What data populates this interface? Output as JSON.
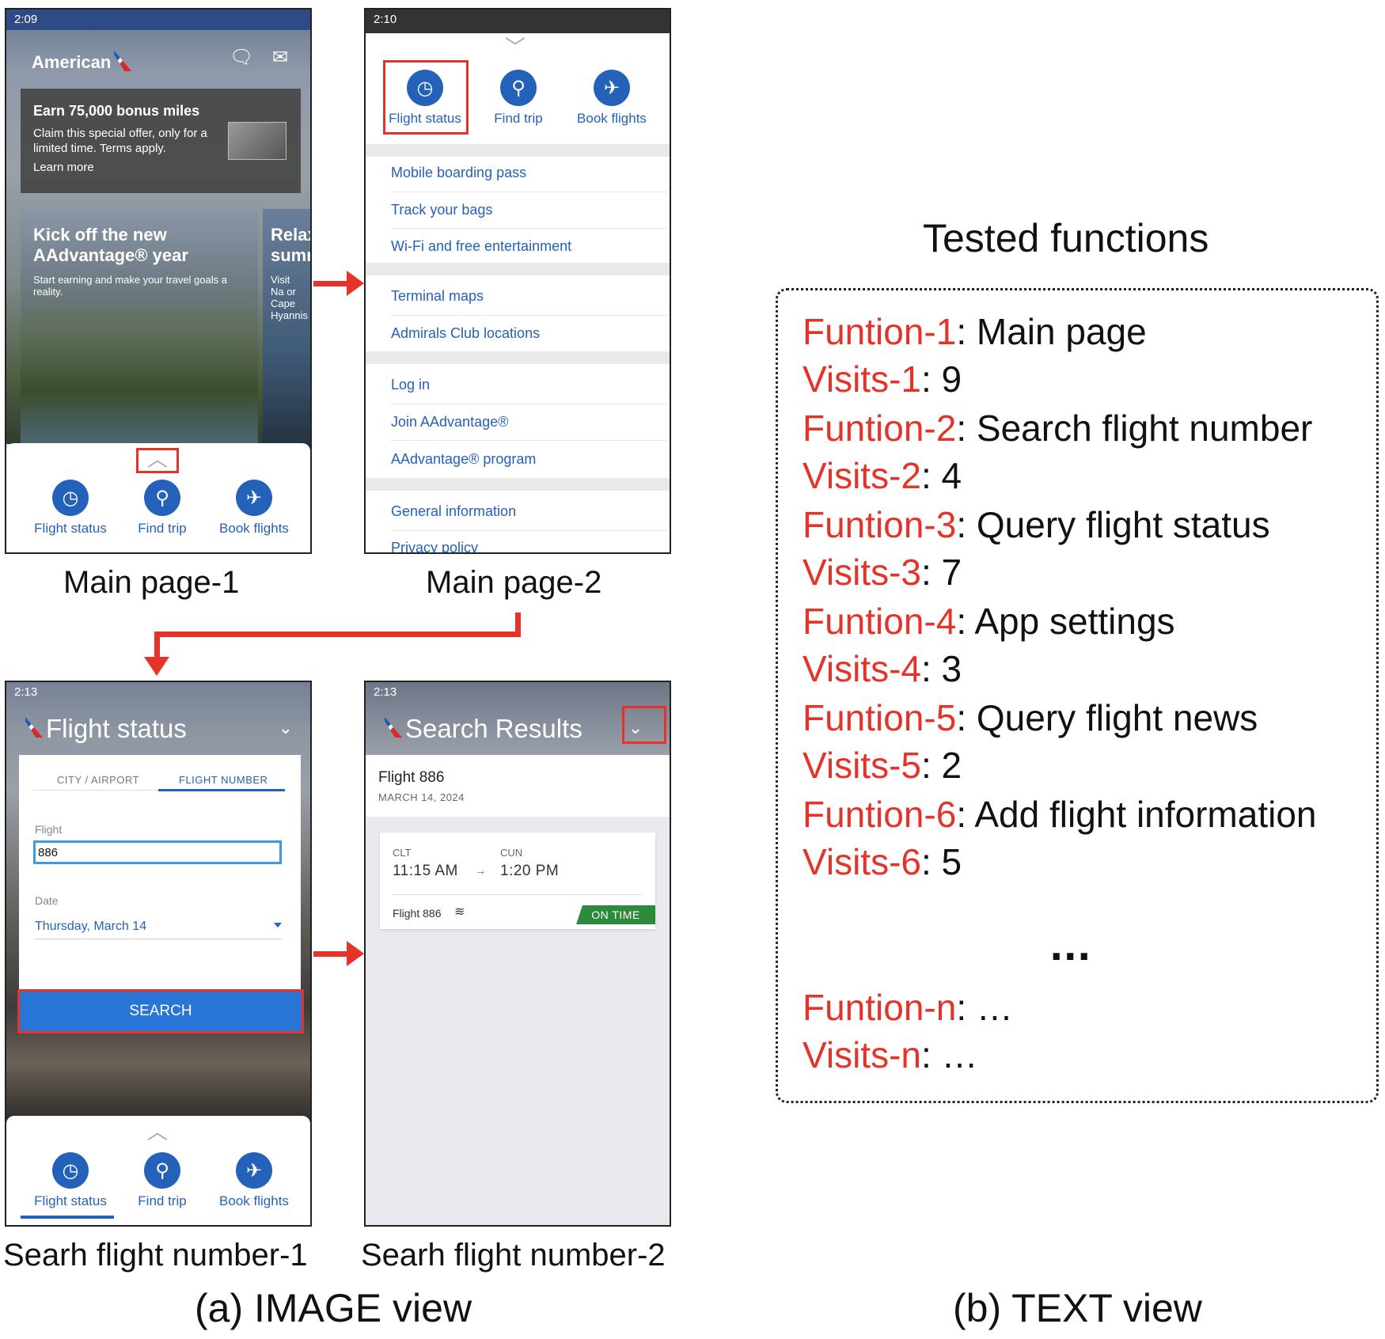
{
  "phone1": {
    "time": "2:09",
    "brand": "American",
    "promo": {
      "title": "Earn 75,000 bonus miles",
      "body": "Claim this special offer, only for a limited time. Terms apply.",
      "link": "Learn more"
    },
    "hero_a": {
      "headline": "Kick off the new AAdvantage® year",
      "sub": "Start earning and make your travel goals a reality."
    },
    "hero_b": {
      "headline": "Relax sumr",
      "sub": "Visit Na or Cape Hyannis"
    },
    "nav": [
      "Flight status",
      "Find trip",
      "Book flights"
    ]
  },
  "phone2": {
    "time": "2:10",
    "nav": [
      "Flight status",
      "Find trip",
      "Book flights"
    ],
    "menu_groups": [
      [
        "Mobile boarding pass",
        "Track your bags",
        "Wi-Fi and free entertainment"
      ],
      [
        "Terminal maps",
        "Admirals Club locations"
      ],
      [
        "Log in",
        "Join AAdvantage®",
        "AAdvantage® program"
      ],
      [
        "General information",
        "Privacy policy"
      ]
    ]
  },
  "phone3": {
    "time": "2:13",
    "title": "Flight status",
    "tabs": [
      "CITY / AIRPORT",
      "FLIGHT NUMBER"
    ],
    "flight_label": "Flight",
    "flight_value": "886",
    "date_label": "Date",
    "date_value": "Thursday, March 14",
    "search": "SEARCH",
    "nav": [
      "Flight status",
      "Find trip",
      "Book flights"
    ]
  },
  "phone4": {
    "time": "2:13",
    "title": "Search Results",
    "flight_title": "Flight 886",
    "date": "MARCH 14, 2024",
    "from_code": "CLT",
    "to_code": "CUN",
    "depart": "11:15 AM",
    "arrive": "1:20 PM",
    "flight_footer": "Flight 886",
    "status": "ON TIME"
  },
  "captions": {
    "main1": "Main page-1",
    "main2": "Main page-2",
    "search1": "Searh flight number-1",
    "search2": "Searh flight number-2",
    "image_view": "(a) IMAGE view",
    "text_view": "(b) TEXT view"
  },
  "text_view": {
    "title": "Tested functions",
    "lines": [
      {
        "key": "Funtion-1",
        "val": "Main page"
      },
      {
        "key": "Visits-1",
        "val": "9"
      },
      {
        "key": "Funtion-2",
        "val": "Search flight number"
      },
      {
        "key": "Visits-2",
        "val": "4"
      },
      {
        "key": "Funtion-3",
        "val": "Query flight status"
      },
      {
        "key": "Visits-3",
        "val": "7"
      },
      {
        "key": "Funtion-4",
        "val": "App settings"
      },
      {
        "key": "Visits-4",
        "val": "3"
      },
      {
        "key": "Funtion-5",
        "val": "Query flight news"
      },
      {
        "key": "Visits-5",
        "val": "2"
      },
      {
        "key": "Funtion-6",
        "val": "Add flight information"
      },
      {
        "key": "Visits-6",
        "val": "5"
      }
    ],
    "ellipsis": "...",
    "tail": [
      {
        "key": "Funtion-n",
        "val": "…"
      },
      {
        "key": "Visits-n",
        "val": " …"
      }
    ]
  },
  "colors": {
    "accent_red": "#e5332a",
    "aa_blue": "#2461b8",
    "on_time_green": "#2c8a3c"
  }
}
